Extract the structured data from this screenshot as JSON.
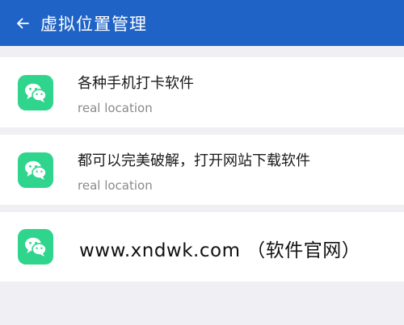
{
  "header": {
    "title": "虚拟位置管理",
    "back_icon": "arrow-left-icon",
    "background": "#1f63c6"
  },
  "list": [
    {
      "icon": "wechat-icon",
      "title": "各种手机打卡软件",
      "subtitle": "real location"
    },
    {
      "icon": "wechat-icon",
      "title": "都可以完美破解，打开网站下载软件",
      "subtitle": "real location"
    },
    {
      "icon": "wechat-icon",
      "title": "www.xndwk.com （软件官网）"
    }
  ],
  "colors": {
    "icon_bg": "#2fd58d",
    "page_bg": "#efeff4"
  }
}
